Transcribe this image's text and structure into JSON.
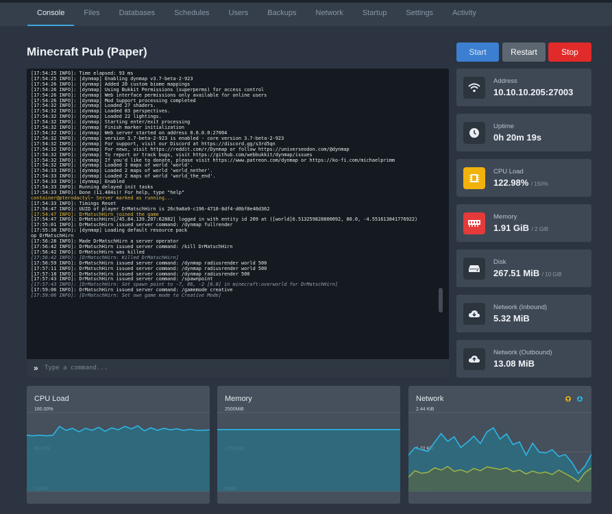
{
  "nav": {
    "tabs": [
      "Console",
      "Files",
      "Databases",
      "Schedules",
      "Users",
      "Backups",
      "Network",
      "Startup",
      "Settings",
      "Activity"
    ],
    "active": "Console"
  },
  "server": {
    "name": "Minecraft Pub (Paper)"
  },
  "controls": {
    "start": "Start",
    "restart": "Restart",
    "stop": "Stop"
  },
  "console": {
    "placeholder": "Type a command...",
    "lines": [
      {
        "t": "[17:54:25 INFO]: Time elapsed: 93 ms",
        "s": "n"
      },
      {
        "t": "[17:54:25 INFO]: [dynmap] Enabling dynmap v3.7-beta-2-923",
        "s": "n"
      },
      {
        "t": "[17:54:26 INFO]: [dynmap] Added 20 custom biome mappings",
        "s": "n"
      },
      {
        "t": "[17:54:26 INFO]: [dynmap] Using Bukkit Permissions (superperms) for access control",
        "s": "n"
      },
      {
        "t": "[17:54:26 INFO]: [dynmap] Web interface permissions only available for online users",
        "s": "n"
      },
      {
        "t": "[17:54:26 INFO]: [dynmap] Mod Support processing completed",
        "s": "n"
      },
      {
        "t": "[17:54:32 INFO]: [dynmap] Loaded 27 shaders.",
        "s": "n"
      },
      {
        "t": "[17:54:32 INFO]: [dynmap] Loaded 83 perspectives.",
        "s": "n"
      },
      {
        "t": "[17:54:32 INFO]: [dynmap] Loaded 22 lightings.",
        "s": "n"
      },
      {
        "t": "[17:54:32 INFO]: [dynmap] Starting enter/exit processing",
        "s": "n"
      },
      {
        "t": "[17:54:32 INFO]: [dynmap] Finish marker initialization",
        "s": "n"
      },
      {
        "t": "[17:54:32 INFO]: [dynmap] Web server started on address 0.0.0.0:27004",
        "s": "n"
      },
      {
        "t": "[17:54:32 INFO]: [dynmap] version 3.7-beta-2-923 is enabled - core version 3.7-beta-2-923",
        "s": "n"
      },
      {
        "t": "[17:54:32 INFO]: [dynmap] For support, visit our Discord at https://discord.gg/s3rd5qn",
        "s": "n"
      },
      {
        "t": "[17:54:32 INFO]: [dynmap] For news, visit https://reddit.com/r/Dynmap or follow https://universeodon.com/@dynmap",
        "s": "n"
      },
      {
        "t": "[17:54:32 INFO]: [dynmap] To report or track bugs, visit https://github.com/webbukkit/dynmap/issues",
        "s": "n"
      },
      {
        "t": "[17:54:32 INFO]: [dynmap] If you'd like to donate, please visit https://www.patreon.com/dynmap or https://ko-fi.com/michaelprimm",
        "s": "n"
      },
      {
        "t": "[17:54:32 INFO]: [dynmap] Loaded 3 maps of world 'world'.",
        "s": "n"
      },
      {
        "t": "[17:54:33 INFO]: [dynmap] Loaded 2 maps of world 'world_nether'.",
        "s": "n"
      },
      {
        "t": "[17:54:33 INFO]: [dynmap] Loaded 2 maps of world 'world_the_end'.",
        "s": "n"
      },
      {
        "t": "[17:54:33 INFO]: [dynmap] Enabled",
        "s": "n"
      },
      {
        "t": "[17:54:33 INFO]: Running delayed init tasks",
        "s": "n"
      },
      {
        "t": "[17:54:33 INFO]: Done (11.484s)! For help, type \"help\"",
        "s": "n"
      },
      {
        "t": "container@pterodactyl~ Server marked as running...",
        "s": "p"
      },
      {
        "t": "[17:54:33 INFO]: Timings Reset",
        "s": "n"
      },
      {
        "t": "[17:54:47 INFO]: UUID of player DrMatschHirn is 26c9a8a9-c196-4710-8df4-d0bf8e40d362",
        "s": "n"
      },
      {
        "t": "[17:54:47 INFO]: DrMatschHirn joined the game",
        "s": "y"
      },
      {
        "t": "[17:54:47 INFO]: DrMatschHirn[/45.84.139.207:62882] logged in with entity id 209 at ([world]6.513259828800092, 80.0, -4.551613841776922)",
        "s": "n"
      },
      {
        "t": "[17:55:01 INFO]: DrMatschHirn issued server command: /dynmap fullrender",
        "s": "n"
      },
      {
        "t": "[17:55:38 INFO]: [dynmap] Loading default resource pack",
        "s": "n"
      },
      {
        "t": "op DrMatschHirn",
        "s": "n"
      },
      {
        "t": "[17:56:28 INFO]: Made DrMatschHirn a server operator",
        "s": "n"
      },
      {
        "t": "[17:56:42 INFO]: DrMatschHirn issued server command: /kill DrMatschHirn",
        "s": "n"
      },
      {
        "t": "[17:56:42 INFO]: DrMatschHirn was killed",
        "s": "n"
      },
      {
        "t": "[17:56:42 INFO]: [DrMatschHirn: Killed DrMatschHirn]",
        "s": "i"
      },
      {
        "t": "[17:56:59 INFO]: DrMatschHirn issued server command: /dynmap radiusrender world 500",
        "s": "n"
      },
      {
        "t": "[17:57:11 INFO]: DrMatschHirn issued server command: /dynmap radiusrender world 500",
        "s": "n"
      },
      {
        "t": "[17:57:18 INFO]: DrMatschHirn issued server command: /dynmap radiusrender 500",
        "s": "n"
      },
      {
        "t": "[17:57:43 INFO]: DrMatschHirn issued server command: /spawnpoint",
        "s": "n"
      },
      {
        "t": "[17:57:43 INFO]: [DrMatschHirn: Set spawn point to -7, 86, -2 [0.0] in minecraft:overworld for DrMatschHirn]",
        "s": "i"
      },
      {
        "t": "[17:59:06 INFO]: DrMatschHirn issued server command: /gamemode creative",
        "s": "n"
      },
      {
        "t": "[17:59:06 INFO]: [DrMatschHirn: Set own game mode to Creative Mode]",
        "s": "i"
      }
    ]
  },
  "stats": [
    {
      "key": "address",
      "label": "Address",
      "value": "10.10.10.205:27003",
      "limit": "",
      "icon": "wifi-icon",
      "icon_bg": "#2c343e"
    },
    {
      "key": "uptime",
      "label": "Uptime",
      "value": "0h 20m 19s",
      "limit": "",
      "icon": "clock-icon",
      "icon_bg": "#2c343e"
    },
    {
      "key": "cpu",
      "label": "CPU Load",
      "value": "122.98%",
      "limit": "/ 150%",
      "icon": "cpu-chip-icon",
      "icon_bg": "#f1b20c"
    },
    {
      "key": "memory",
      "label": "Memory",
      "value": "1.91 GiB",
      "limit": "/ 2 GiB",
      "icon": "memory-icon",
      "icon_bg": "#e53a3a"
    },
    {
      "key": "disk",
      "label": "Disk",
      "value": "267.51 MiB",
      "limit": "/ 10 GiB",
      "icon": "hard-drive-icon",
      "icon_bg": "#2c343e"
    },
    {
      "key": "net_in",
      "label": "Network (Inbound)",
      "value": "5.32 MiB",
      "limit": "",
      "icon": "cloud-download-icon",
      "icon_bg": "#2c343e"
    },
    {
      "key": "net_out",
      "label": "Network (Outbound)",
      "value": "13.08 MiB",
      "limit": "",
      "icon": "cloud-upload-icon",
      "icon_bg": "#2c343e"
    }
  ],
  "colors": {
    "accent": "#3fa7e0",
    "line_primary": "#2fb6e6",
    "fill_primary": "#2c6d80",
    "line_secondary": "#9bb24a",
    "fill_secondary": "#4d6650"
  },
  "legend_icons": [
    "upload-arrow-icon",
    "download-arrow-icon"
  ],
  "chart_data": [
    {
      "type": "area",
      "title": "CPU Load",
      "yticks": [
        "160.00%",
        "80.00%",
        "0.00%"
      ],
      "ylim": [
        0,
        160
      ],
      "series": [
        {
          "values": [
            114,
            113,
            114,
            113,
            114,
            132,
            124,
            128,
            121,
            128,
            124,
            130,
            122,
            129,
            125,
            132,
            127,
            133,
            123,
            129,
            124,
            128,
            125,
            127,
            124,
            126,
            124,
            124,
            125
          ]
        }
      ]
    },
    {
      "type": "area",
      "title": "Memory",
      "yticks": [
        "2500MiB",
        "1250MiB",
        "0MiB"
      ],
      "ylim": [
        0,
        2500
      ],
      "series": [
        {
          "values": [
            1960,
            1960,
            1960,
            1960,
            1960,
            1960,
            1960,
            1960,
            1960,
            1960,
            1960,
            1960,
            1960,
            1960,
            1960,
            1960,
            1960,
            1960,
            1960,
            1960,
            1960,
            1960,
            1960,
            1960,
            1960,
            1960,
            1960,
            1960,
            1960
          ]
        }
      ]
    },
    {
      "type": "area",
      "title": "Network",
      "yticks": [
        "2.44 KiB",
        "1.22 KiB",
        "0 Bytes"
      ],
      "ylim": [
        0,
        2.44
      ],
      "series": [
        {
          "values": [
            1.12,
            1.36,
            1.29,
            1.24,
            1.52,
            1.79,
            1.55,
            1.69,
            1.36,
            1.52,
            1.71,
            1.48,
            1.84,
            1.97,
            1.62,
            1.78,
            1.45,
            1.53,
            1.12,
            1.49,
            1.22,
            1.19,
            1.29,
            1.08,
            1.14,
            0.9,
            0.56,
            0.78,
            1.15
          ]
        },
        {
          "values": [
            0.44,
            0.64,
            0.56,
            0.59,
            0.73,
            0.66,
            0.77,
            0.62,
            0.67,
            0.59,
            0.71,
            0.64,
            0.76,
            0.72,
            0.68,
            0.73,
            0.61,
            0.66,
            0.54,
            0.63,
            0.56,
            0.6,
            0.52,
            0.66,
            0.55,
            0.44,
            0.3,
            0.58,
            0.72
          ]
        }
      ]
    }
  ]
}
